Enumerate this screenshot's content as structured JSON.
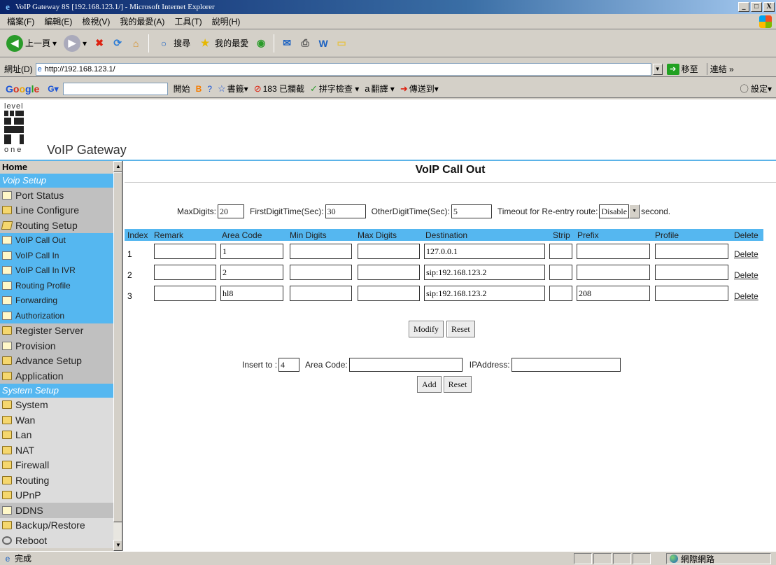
{
  "window": {
    "title": "VoIP Gateway 8S [192.168.123.1/] - Microsoft Internet Explorer",
    "min": "_",
    "max": "□",
    "close": "X"
  },
  "menu": [
    "檔案(F)",
    "編輯(E)",
    "檢視(V)",
    "我的最愛(A)",
    "工具(T)",
    "說明(H)"
  ],
  "toolbar": {
    "back": "上一頁",
    "search": "搜尋",
    "favorites": "我的最愛"
  },
  "address": {
    "label": "網址(D)",
    "url": "http://192.168.123.1/",
    "go": "移至",
    "links": "連結 »"
  },
  "googlebar": {
    "start": "開始",
    "bookmarks": "書籤▾",
    "blocked": "183 已攔截",
    "spellcheck": "拼字檢查 ▾",
    "translate": "翻譯 ▾",
    "sendto": "傳送到▾",
    "settings": "◯ 設定▾"
  },
  "header": {
    "logo_top": "level",
    "logo_bottom": "one",
    "brand": "VoIP Gateway"
  },
  "sidebar": {
    "home": "Home",
    "voip_section": "Voip Setup",
    "voip_items": [
      "Port Status",
      "Line Configure",
      "Routing Setup"
    ],
    "routing_items": [
      "VoIP Call Out",
      "VoIP Call In",
      "VoIP Call In IVR",
      "Routing Profile",
      "Forwarding",
      "Authorization"
    ],
    "more_items": [
      "Register Server",
      "Provision",
      "Advance Setup",
      "Application"
    ],
    "system_section": "System Setup",
    "system_items": [
      "System",
      "Wan",
      "Lan",
      "NAT",
      "Firewall",
      "Routing",
      "UPnP",
      "DDNS",
      "Backup/Restore",
      "Reboot"
    ]
  },
  "main": {
    "title": "VoIP Call Out",
    "max_digits_label": "MaxDigits:",
    "max_digits": "20",
    "first_digit_label": "FirstDigitTime(Sec):",
    "first_digit": "30",
    "other_digit_label": "OtherDigitTime(Sec):",
    "other_digit": "5",
    "timeout_label": "Timeout for Re-entry route:",
    "timeout_value": "Disable",
    "timeout_unit": "second.",
    "columns": [
      "Index",
      "Remark",
      "Area Code",
      "Min Digits",
      "Max Digits",
      "Destination",
      "Strip",
      "Prefix",
      "Profile",
      "Delete"
    ],
    "rows": [
      {
        "index": "1",
        "remark": "",
        "area": "1",
        "min": "",
        "max": "",
        "dest": "127.0.0.1",
        "strip": "",
        "prefix": "",
        "profile": "",
        "del": "Delete"
      },
      {
        "index": "2",
        "remark": "",
        "area": "2",
        "min": "",
        "max": "",
        "dest": "sip:192.168.123.2",
        "strip": "",
        "prefix": "",
        "profile": "",
        "del": "Delete"
      },
      {
        "index": "3",
        "remark": "",
        "area": "hl8",
        "min": "",
        "max": "",
        "dest": "sip:192.168.123.2",
        "strip": "",
        "prefix": "208",
        "profile": "",
        "del": "Delete"
      }
    ],
    "modify_btn": "Modify",
    "reset_btn": "Reset",
    "insert_label": "Insert  to :",
    "insert_value": "4",
    "area_code_label": "Area Code:",
    "area_code_value": "",
    "ip_label": "IPAddress:",
    "ip_value": "",
    "add_btn": "Add",
    "reset2_btn": "Reset"
  },
  "status": {
    "text": "完成",
    "zone": "網際網路"
  }
}
